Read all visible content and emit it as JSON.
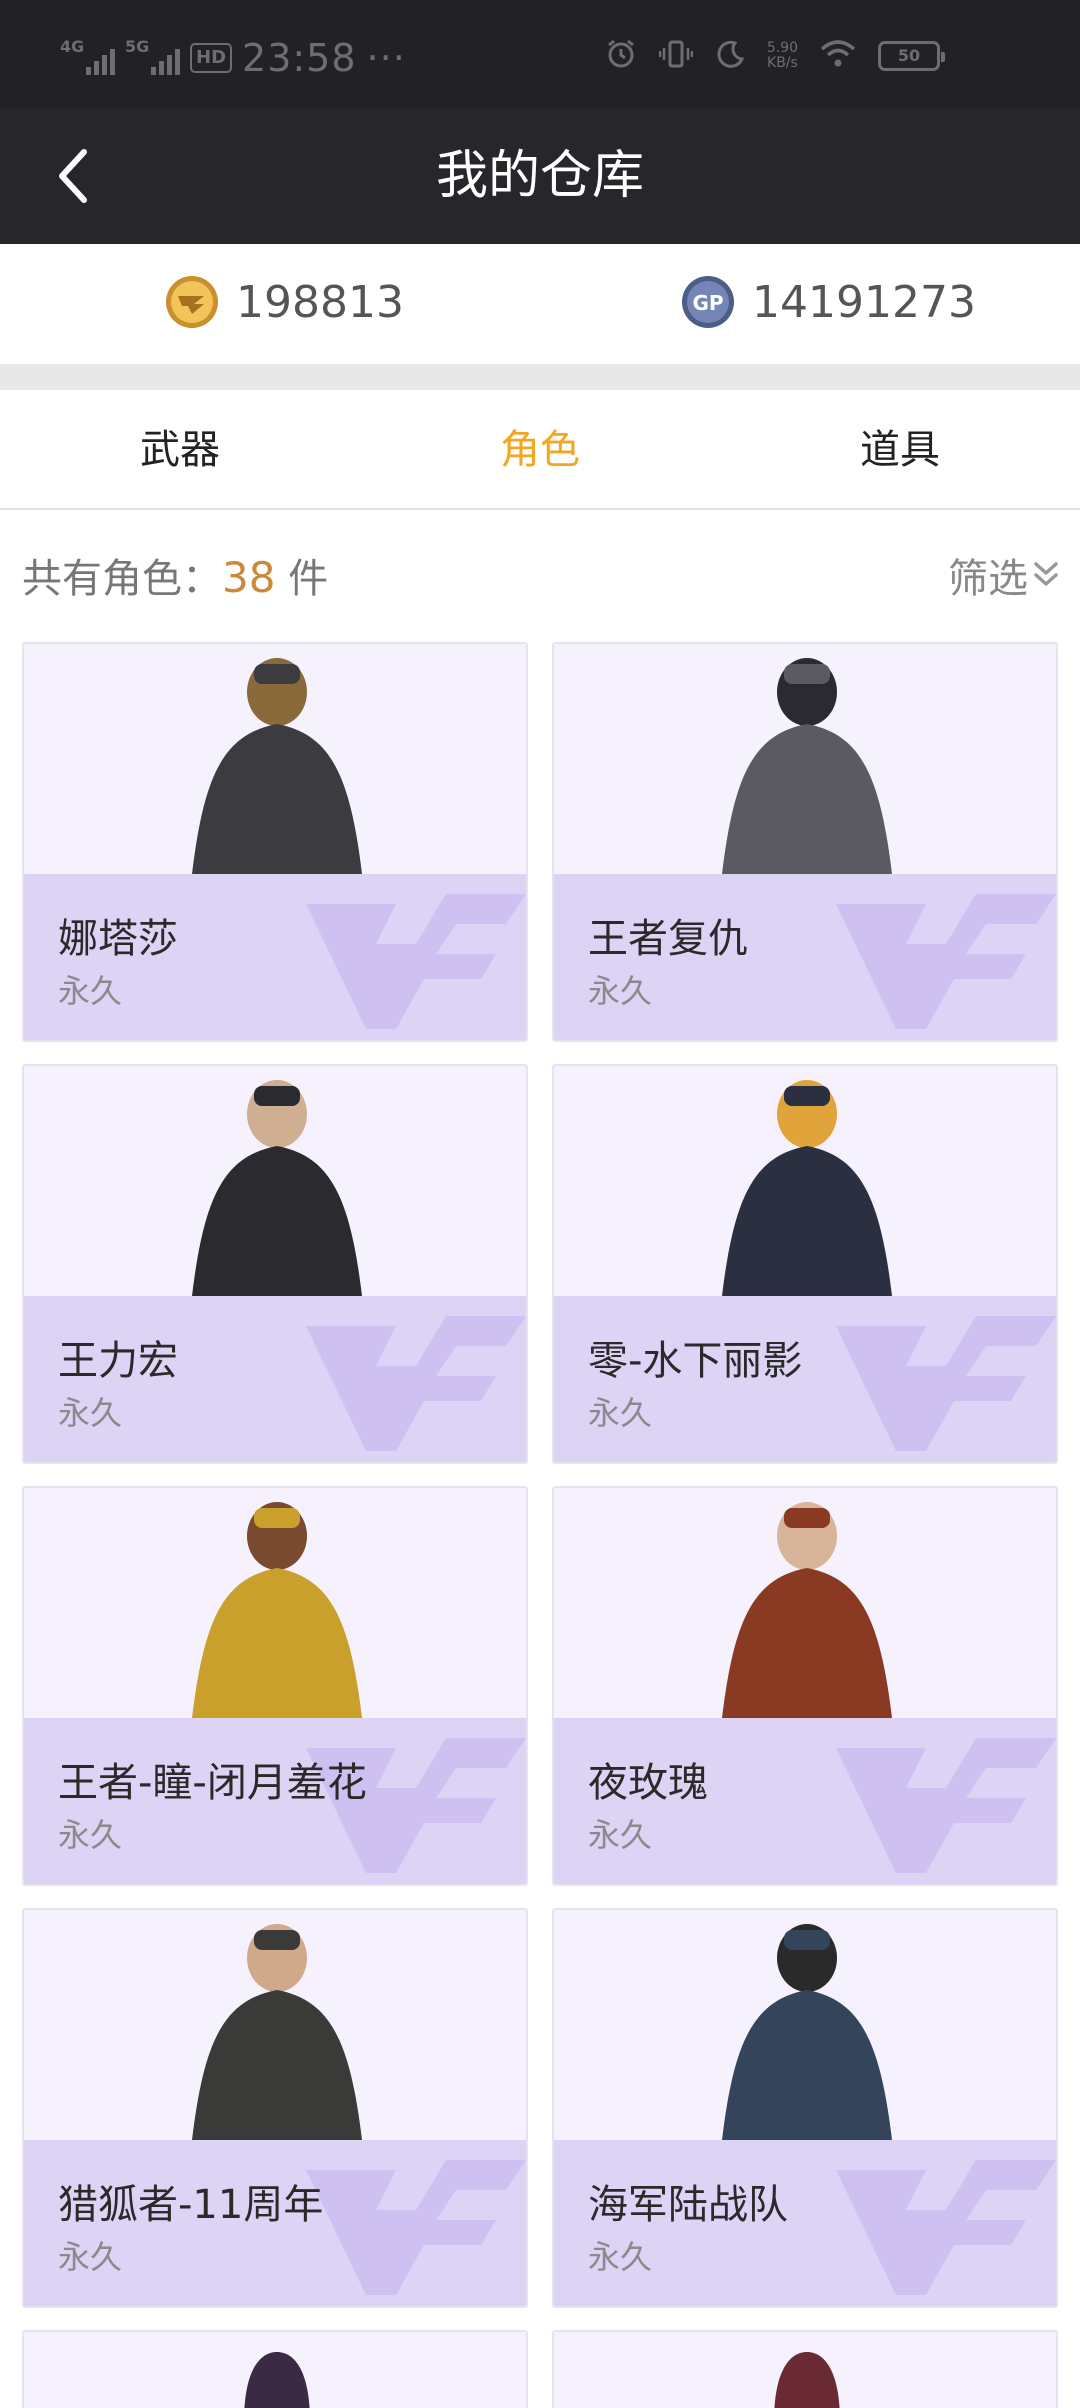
{
  "status_bar": {
    "sig1_label": "4G",
    "sig2_label": "5G",
    "hd_label": "HD",
    "time": "23:58",
    "dots": "···",
    "net_speed_value": "5.90",
    "net_speed_unit": "KB/s",
    "battery": "50"
  },
  "header": {
    "title": "我的仓库"
  },
  "currency": {
    "cf_points": "198813",
    "gp_icon_label": "GP",
    "gp_points": "14191273"
  },
  "tabs": [
    {
      "label": "武器"
    },
    {
      "label": "角色"
    },
    {
      "label": "道具"
    }
  ],
  "active_tab": 1,
  "summary": {
    "label": "共有角色：",
    "count": "38",
    "unit": " 件",
    "filter_label": "筛选"
  },
  "characters": [
    {
      "name": "娜塔莎",
      "duration": "永久"
    },
    {
      "name": "王者复仇",
      "duration": "永久"
    },
    {
      "name": "王力宏",
      "duration": "永久"
    },
    {
      "name": "零-水下丽影",
      "duration": "永久"
    },
    {
      "name": "王者-瞳-闭月羞花",
      "duration": "永久"
    },
    {
      "name": "夜玫瑰",
      "duration": "永久"
    },
    {
      "name": "猎狐者-11周年",
      "duration": "永久"
    },
    {
      "name": "海军陆战队",
      "duration": "永久"
    }
  ],
  "colors": {
    "accent": "#f3a622",
    "header_bg": "#27272b",
    "card_top": "#f5f2fd",
    "card_bottom": "#ddd3f5",
    "count": "#c98a3a"
  }
}
